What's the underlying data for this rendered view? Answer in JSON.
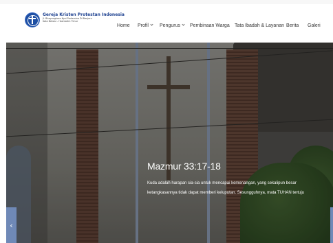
{
  "site": {
    "title": "Gereja Kristen Protestan Indonesia",
    "subtitle_line1": "Jl. Bhayangkara Kyai Pertamina Dl Banjaru",
    "subtitle_line2": "Kota Bekasi - Hasmatim Timur"
  },
  "nav": {
    "items": [
      {
        "label": "Home",
        "has_dropdown": false
      },
      {
        "label": "Profil",
        "has_dropdown": true
      },
      {
        "label": "Pengurus",
        "has_dropdown": true
      },
      {
        "label": "Pembinaan Warga",
        "has_dropdown": false
      },
      {
        "label": "Tata Ibadah & Layanan",
        "has_dropdown": false
      },
      {
        "label": "Berita",
        "has_dropdown": false
      },
      {
        "label": "Galeri",
        "has_dropdown": false
      }
    ]
  },
  "hero": {
    "title": "Mazmur 33:17-18",
    "text": "Kuda adalah harapan sia-sia untuk mencapai kemenangan, yang sekalipun besar ketangkasannya tidak dapat memberi keluputan. Sesungguhnya, mata TUHAN tertuju",
    "prev_icon": "chevron-left-icon"
  },
  "colors": {
    "brand_blue": "#1e4fa3",
    "slider_button": "#6f89b7"
  }
}
